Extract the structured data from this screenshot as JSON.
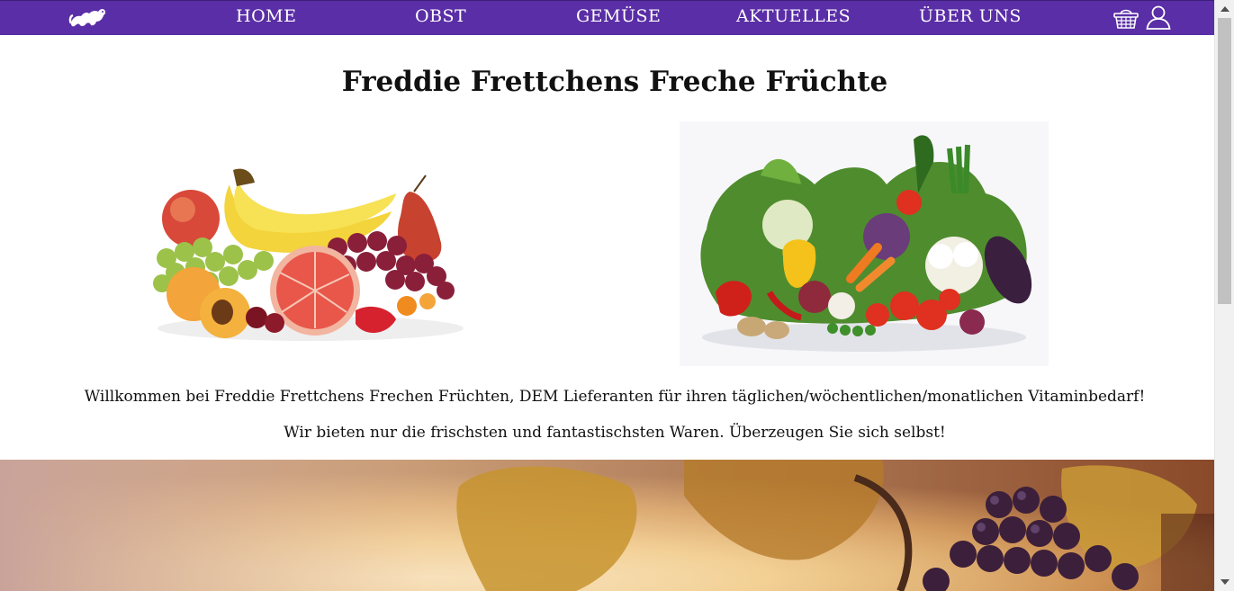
{
  "nav": {
    "home": "HOME",
    "obst": "OBST",
    "gemuese": "GEMÜSE",
    "aktuelles": "AKTUELLES",
    "ueber_uns": "ÜBER UNS",
    "logo_icon": "ferret-icon",
    "basket_icon": "basket-icon",
    "user_icon": "user-icon"
  },
  "colors": {
    "nav_bg": "#5a2ea6",
    "nav_text": "#ffffff"
  },
  "main": {
    "title": "Freddie Frettchens Freche Früchte",
    "intro_line1": "Willkommen bei Freddie Frettchens Frechen Früchten, DEM Lieferanten für ihren täglichen/wöchentlichen/monatlichen Vitaminbedarf!",
    "intro_line2": "Wir bieten nur die frischsten und fantastischsten Waren. Überzeugen Sie sich selbst!"
  }
}
